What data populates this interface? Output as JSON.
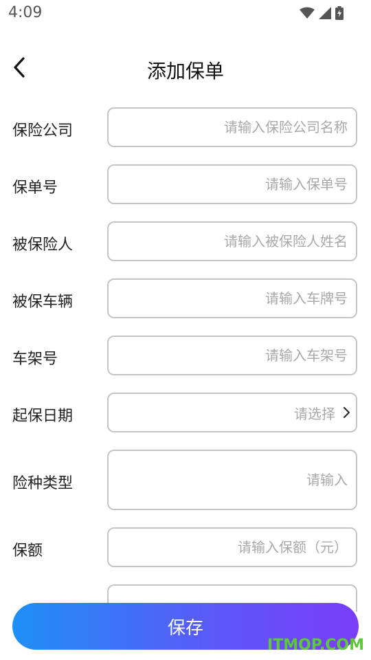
{
  "status_bar": {
    "time": "4:09"
  },
  "header": {
    "title": "添加保单"
  },
  "form": {
    "fields": [
      {
        "label": "保险公司",
        "placeholder": "请输入保险公司名称"
      },
      {
        "label": "保单号",
        "placeholder": "请输入保单号"
      },
      {
        "label": "被保险人",
        "placeholder": "请输入被保险人姓名"
      },
      {
        "label": "被保车辆",
        "placeholder": "请输入车牌号"
      },
      {
        "label": "车架号",
        "placeholder": "请输入车架号"
      },
      {
        "label": "起保日期",
        "select_text": "请选择"
      },
      {
        "label": "险种类型",
        "placeholder": "请输入"
      },
      {
        "label": "保额",
        "placeholder": "请输入保额（元）"
      }
    ]
  },
  "save_button": {
    "label": "保存"
  },
  "watermark": {
    "text": "ITMOP.COM"
  },
  "colors": {
    "accent_start": "#1e8ff7",
    "accent_end": "#7a3cf8",
    "watermark": "#5cc83a"
  }
}
